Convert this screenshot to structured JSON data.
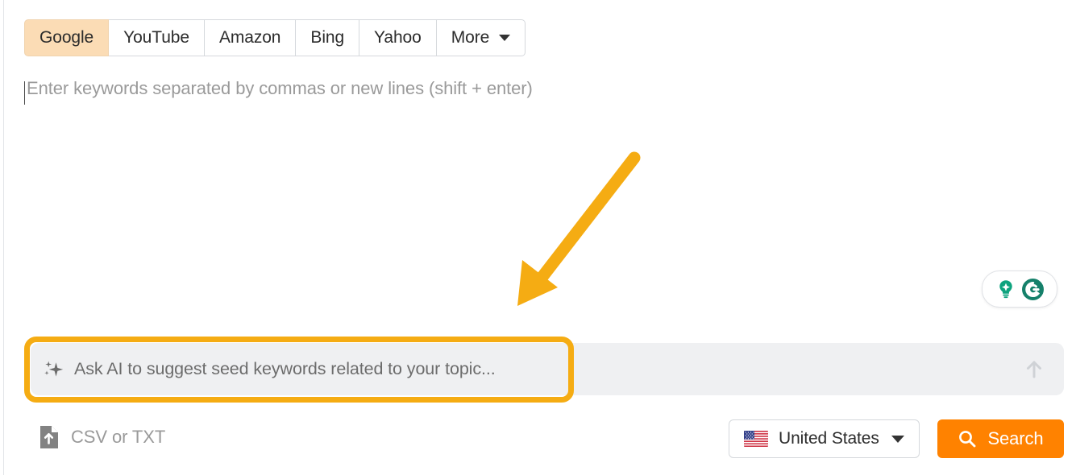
{
  "engine_tabs": {
    "items": [
      {
        "label": "Google",
        "active": true
      },
      {
        "label": "YouTube",
        "active": false
      },
      {
        "label": "Amazon",
        "active": false
      },
      {
        "label": "Bing",
        "active": false
      },
      {
        "label": "Yahoo",
        "active": false
      },
      {
        "label": "More",
        "active": false,
        "icon": "chevron-down-icon"
      }
    ]
  },
  "keywords_input": {
    "placeholder": "Enter keywords separated by commas or new lines (shift + enter)",
    "value": "",
    "caret_visible": true
  },
  "annotation": {
    "type": "arrow",
    "color": "#f5ac13",
    "direction": "down-left",
    "points_to": "ai-prompt-bar"
  },
  "grammarly_widget": {
    "icons": [
      "lightbulb-idea-icon",
      "grammarly-logo-icon"
    ],
    "lightbulb_color": "#0ea37e",
    "logo_color": "#15806a"
  },
  "ai_prompt": {
    "icon": "sparkle-icon",
    "placeholder": "Ask AI to suggest seed keywords related to your topic...",
    "value": "",
    "submit_icon": "arrow-up-icon",
    "highlighted": true,
    "highlight_color": "#f5ac13",
    "background": "#eff0f2"
  },
  "upload": {
    "icon": "file-upload-icon",
    "label": "CSV or TXT"
  },
  "country": {
    "icon": "us-flag-icon",
    "label": "United States",
    "caret": "chevron-down-icon"
  },
  "search_button": {
    "icon": "search-icon",
    "label": "Search",
    "color": "#ff8200"
  }
}
